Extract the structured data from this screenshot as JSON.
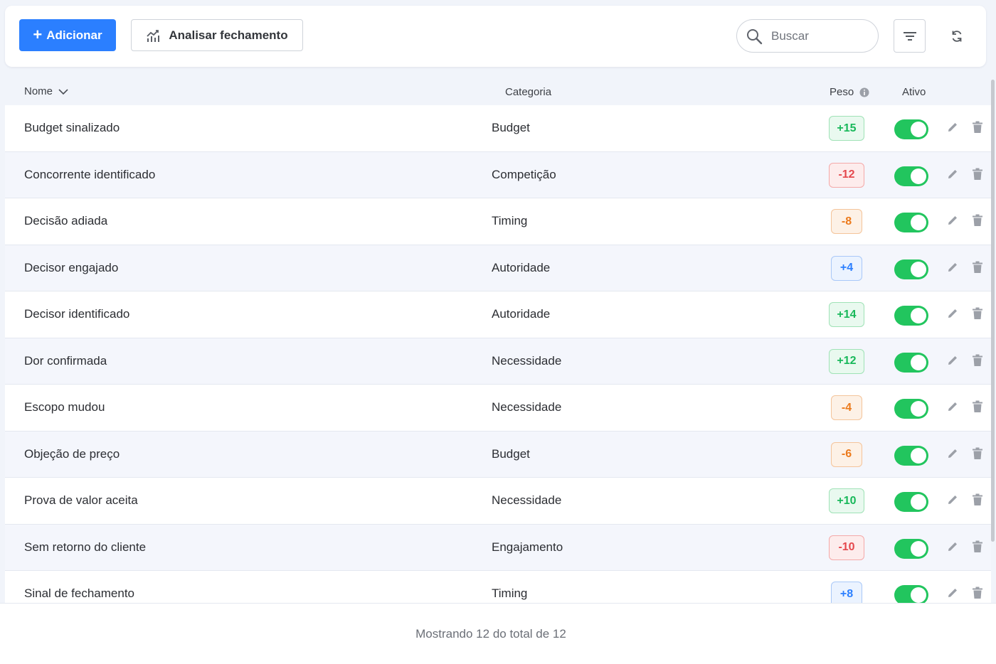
{
  "toolbar": {
    "add_label": "Adicionar",
    "analyze_label": "Analisar fechamento",
    "search_placeholder": "Buscar",
    "search_value": ""
  },
  "table": {
    "headers": {
      "name": "Nome",
      "category": "Categoria",
      "weight": "Peso",
      "active": "Ativo"
    },
    "rows": [
      {
        "name": "Budget sinalizado",
        "category": "Budget",
        "weight": "+15",
        "weight_color": "green",
        "active": true
      },
      {
        "name": "Concorrente identificado",
        "category": "Competição",
        "weight": "-12",
        "weight_color": "red",
        "active": true
      },
      {
        "name": "Decisão adiada",
        "category": "Timing",
        "weight": "-8",
        "weight_color": "orange",
        "active": true
      },
      {
        "name": "Decisor engajado",
        "category": "Autoridade",
        "weight": "+4",
        "weight_color": "blue",
        "active": true
      },
      {
        "name": "Decisor identificado",
        "category": "Autoridade",
        "weight": "+14",
        "weight_color": "green",
        "active": true
      },
      {
        "name": "Dor confirmada",
        "category": "Necessidade",
        "weight": "+12",
        "weight_color": "green",
        "active": true
      },
      {
        "name": "Escopo mudou",
        "category": "Necessidade",
        "weight": "-4",
        "weight_color": "orange",
        "active": true
      },
      {
        "name": "Objeção de preço",
        "category": "Budget",
        "weight": "-6",
        "weight_color": "orange",
        "active": true
      },
      {
        "name": "Prova de valor aceita",
        "category": "Necessidade",
        "weight": "+10",
        "weight_color": "green",
        "active": true
      },
      {
        "name": "Sem retorno do cliente",
        "category": "Engajamento",
        "weight": "-10",
        "weight_color": "red",
        "active": true
      },
      {
        "name": "Sinal de fechamento",
        "category": "Timing",
        "weight": "+8",
        "weight_color": "blue",
        "active": true
      }
    ]
  },
  "footer": {
    "summary": "Mostrando 12 do total de 12"
  },
  "colors": {
    "accent": "#2b7fff",
    "toggle_on": "#22c55e"
  },
  "icons": {
    "add": "plus-icon",
    "analyze": "chart-trend-icon",
    "search": "search-icon",
    "filter": "filter-icon",
    "refresh": "refresh-icon",
    "sort": "chevron-down-icon",
    "info": "info-icon",
    "edit": "pencil-icon",
    "delete": "trash-icon"
  }
}
